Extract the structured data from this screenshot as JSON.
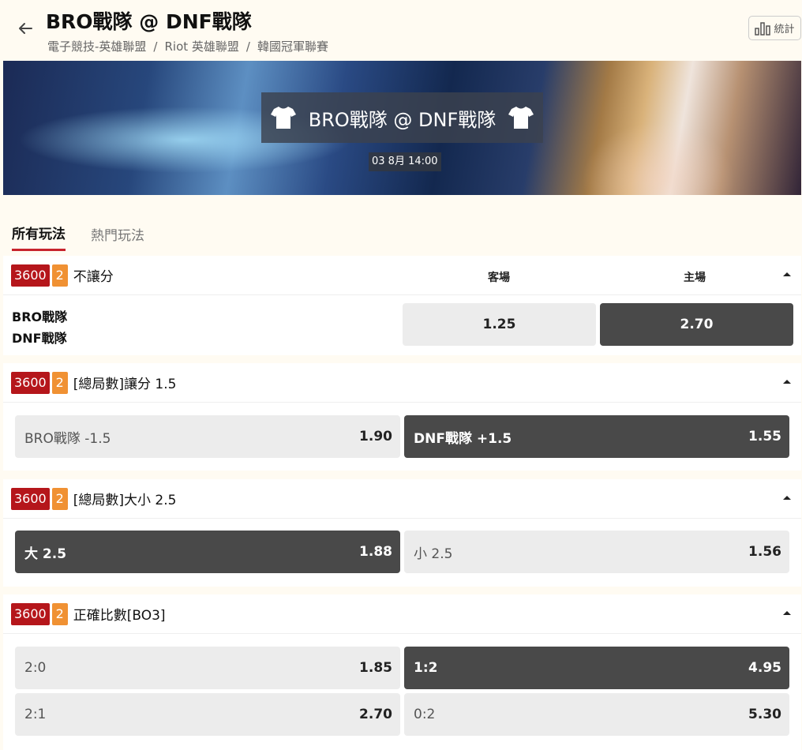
{
  "header": {
    "title": "BRO戰隊 @ DNF戰隊",
    "breadcrumbs": [
      "電子競技-英雄聯盟",
      "Riot 英雄聯盟",
      "韓國冠軍聯賽"
    ],
    "stats_label": "統計"
  },
  "banner": {
    "title": "BRO戰隊 @ DNF戰隊",
    "date": "03 8月 14:00"
  },
  "tabs": {
    "all": "所有玩法",
    "popular": "熱門玩法"
  },
  "markets": [
    {
      "id": "3600",
      "count": "2",
      "name": "不讓分",
      "col_away": "客場",
      "col_home": "主場",
      "teams": [
        "BRO戰隊",
        "DNF戰隊"
      ],
      "odds": [
        {
          "price": "1.25"
        },
        {
          "price": "2.70"
        }
      ]
    },
    {
      "id": "3600",
      "count": "2",
      "name": "[總局數]讓分 1.5",
      "odds": [
        {
          "label": "BRO戰隊 -1.5",
          "price": "1.90"
        },
        {
          "label": "DNF戰隊 +1.5",
          "price": "1.55"
        }
      ]
    },
    {
      "id": "3600",
      "count": "2",
      "name": "[總局數]大小 2.5",
      "odds": [
        {
          "label": "大 2.5",
          "price": "1.88"
        },
        {
          "label": "小 2.5",
          "price": "1.56"
        }
      ]
    },
    {
      "id": "3600",
      "count": "2",
      "name": "正確比數[BO3]",
      "odds": [
        {
          "label": "2:0",
          "price": "1.85"
        },
        {
          "label": "1:2",
          "price": "4.95"
        },
        {
          "label": "2:1",
          "price": "2.70"
        },
        {
          "label": "0:2",
          "price": "5.30"
        }
      ]
    }
  ],
  "colors": {
    "accent": "#c8232c",
    "badge_id": "#b5161b",
    "badge_count": "#f09133",
    "odd_selected": "#494949",
    "odd_default": "#ececec"
  }
}
